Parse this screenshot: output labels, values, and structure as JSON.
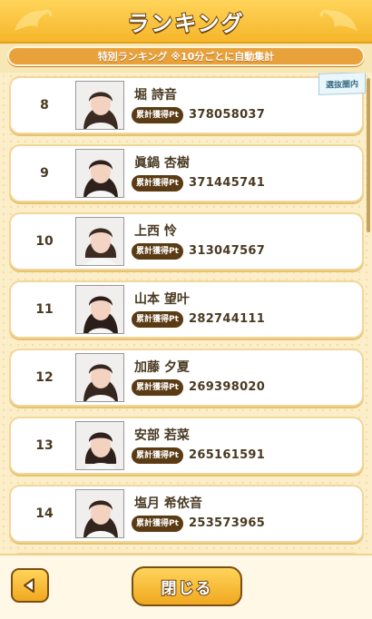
{
  "header": {
    "title": "ランキング"
  },
  "subtitle": "特別ランキング ※10分ごとに自動集計",
  "badge_label": "累計獲得Pt",
  "ribbon_label": "選抜圏内",
  "entries": [
    {
      "rank": "8",
      "name": "堀 詩音",
      "score": "378058037"
    },
    {
      "rank": "9",
      "name": "眞鍋 杏樹",
      "score": "371445741"
    },
    {
      "rank": "10",
      "name": "上西 怜",
      "score": "313047567"
    },
    {
      "rank": "11",
      "name": "山本 望叶",
      "score": "282744111"
    },
    {
      "rank": "12",
      "name": "加藤 夕夏",
      "score": "269398020"
    },
    {
      "rank": "13",
      "name": "安部 若菜",
      "score": "265161591"
    },
    {
      "rank": "14",
      "name": "塩月 希依音",
      "score": "253573965"
    }
  ],
  "footer": {
    "close_label": "閉じる",
    "back_icon": "left-triangle-icon"
  },
  "colors": {
    "accent": "#f5b62a",
    "text": "#4a3a22",
    "badge": "#5a3b14"
  }
}
